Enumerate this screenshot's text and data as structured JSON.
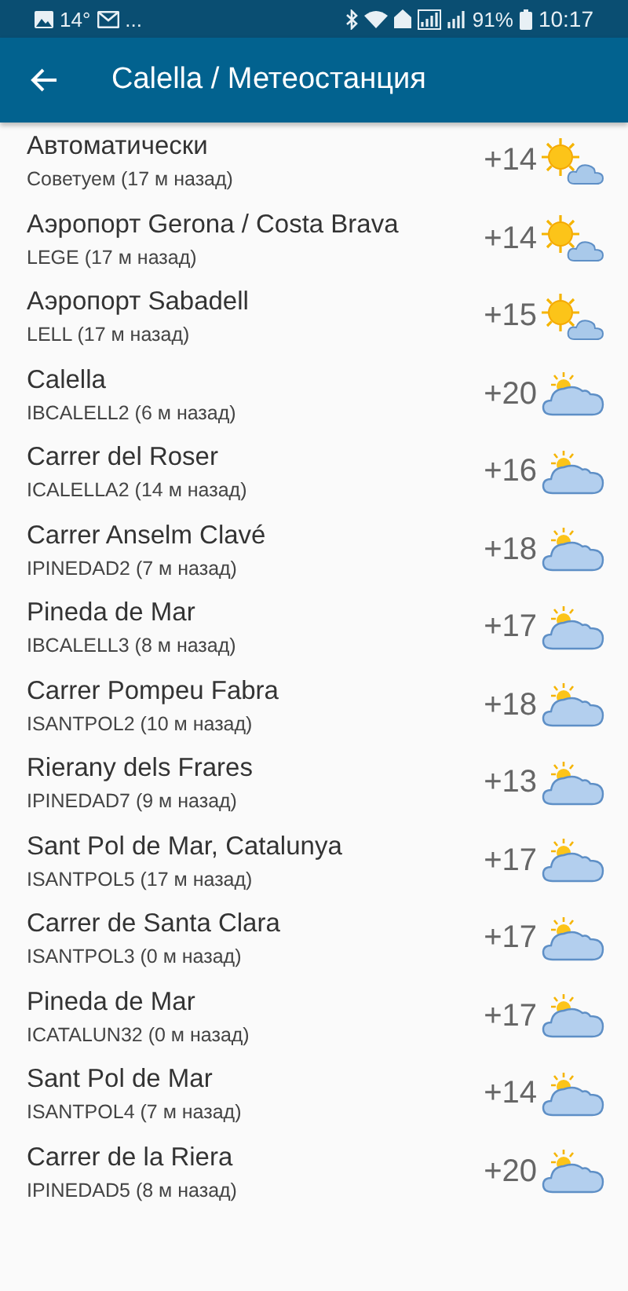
{
  "status_bar": {
    "temperature": "14°",
    "more": "...",
    "battery": "91%",
    "time": "10:17"
  },
  "app_bar": {
    "title": "Calella / Метеостанция"
  },
  "stations": [
    {
      "name": "Автоматически",
      "detail": "Советуем (17 м назад)",
      "temp": "+14",
      "kind": "sunny"
    },
    {
      "name": "Аэропорт Gerona / Costa Brava",
      "detail": "LEGE (17 м назад)",
      "temp": "+14",
      "kind": "sunny"
    },
    {
      "name": "Аэропорт Sabadell",
      "detail": "LELL (17 м назад)",
      "temp": "+15",
      "kind": "sunny"
    },
    {
      "name": "Calella",
      "detail": "IBCALELL2 (6 м назад)",
      "temp": "+20",
      "kind": "cloudy"
    },
    {
      "name": "Carrer del Roser",
      "detail": "ICALELLA2 (14 м назад)",
      "temp": "+16",
      "kind": "cloudy"
    },
    {
      "name": "Carrer Anselm Clavé",
      "detail": "IPINEDAD2 (7 м назад)",
      "temp": "+18",
      "kind": "cloudy"
    },
    {
      "name": "Pineda de Mar",
      "detail": "IBCALELL3 (8 м назад)",
      "temp": "+17",
      "kind": "cloudy"
    },
    {
      "name": "Carrer Pompeu Fabra",
      "detail": "ISANTPOL2 (10 м назад)",
      "temp": "+18",
      "kind": "cloudy"
    },
    {
      "name": "Rierany dels Frares",
      "detail": "IPINEDAD7 (9 м назад)",
      "temp": "+13",
      "kind": "cloudy"
    },
    {
      "name": "Sant Pol de Mar, Catalunya",
      "detail": "ISANTPOL5 (17 м назад)",
      "temp": "+17",
      "kind": "cloudy"
    },
    {
      "name": "Carrer de Santa Clara",
      "detail": "ISANTPOL3 (0 м назад)",
      "temp": "+17",
      "kind": "cloudy"
    },
    {
      "name": "Pineda de Mar",
      "detail": "ICATALUN32 (0 м назад)",
      "temp": "+17",
      "kind": "cloudy"
    },
    {
      "name": "Sant Pol de Mar",
      "detail": "ISANTPOL4 (7 м назад)",
      "temp": "+14",
      "kind": "cloudy"
    },
    {
      "name": "Carrer de la Riera",
      "detail": "IPINEDAD5 (8 м назад)",
      "temp": "+20",
      "kind": "cloudy"
    }
  ]
}
